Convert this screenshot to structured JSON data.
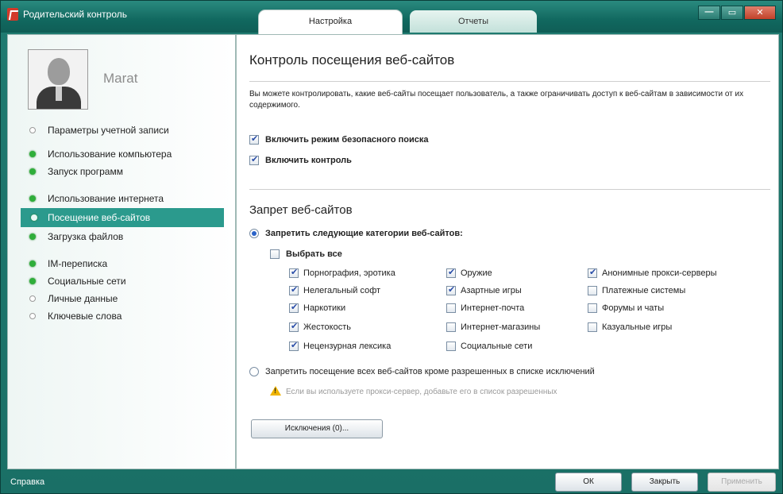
{
  "window": {
    "title": "Родительский контроль",
    "tabs": [
      {
        "label": "Настройка",
        "active": true
      },
      {
        "label": "Отчеты",
        "active": false
      }
    ],
    "controls": {
      "minimize": "—",
      "maximize": "▭",
      "close": "✕"
    }
  },
  "sidebar": {
    "user_name": "Marat",
    "items": [
      {
        "label": "Параметры учетной записи",
        "status": "off"
      },
      {
        "label": "Использование компьютера",
        "status": "on"
      },
      {
        "label": "Запуск программ",
        "status": "on"
      },
      {
        "label": "Использование интернета",
        "status": "on"
      },
      {
        "label": "Посещение веб-сайтов",
        "status": "on",
        "selected": true
      },
      {
        "label": "Загрузка файлов",
        "status": "on"
      },
      {
        "label": "IM-переписка",
        "status": "on"
      },
      {
        "label": "Социальные сети",
        "status": "on"
      },
      {
        "label": "Личные данные",
        "status": "off"
      },
      {
        "label": "Ключевые слова",
        "status": "off"
      }
    ]
  },
  "main": {
    "title": "Контроль посещения веб-сайтов",
    "description": "Вы можете контролировать, какие веб-сайты посещает пользователь, а также ограничивать доступ к веб-сайтам в зависимости от их содержимого.",
    "safe_search_label": "Включить режим безопасного поиска",
    "safe_search_checked": true,
    "control_label": "Включить контроль",
    "control_checked": true,
    "block_title": "Запрет веб-сайтов",
    "block_categories_label": "Запретить следующие категории веб-сайтов:",
    "block_categories_selected": true,
    "select_all_label": "Выбрать все",
    "select_all_checked": false,
    "categories": [
      {
        "label": "Порнография, эротика",
        "checked": true
      },
      {
        "label": "Нелегальный софт",
        "checked": true
      },
      {
        "label": "Наркотики",
        "checked": true
      },
      {
        "label": "Жестокость",
        "checked": true
      },
      {
        "label": "Нецензурная лексика",
        "checked": true
      },
      {
        "label": "Оружие",
        "checked": true
      },
      {
        "label": "Азартные игры",
        "checked": true
      },
      {
        "label": "Интернет-почта",
        "checked": false
      },
      {
        "label": "Интернет-магазины",
        "checked": false
      },
      {
        "label": "Социальные сети",
        "checked": false
      },
      {
        "label": "Анонимные прокси-серверы",
        "checked": true
      },
      {
        "label": "Платежные системы",
        "checked": false
      },
      {
        "label": "Форумы и чаты",
        "checked": false
      },
      {
        "label": "Казуальные игры",
        "checked": false
      }
    ],
    "block_all_label": "Запретить посещение всех веб-сайтов кроме разрешенных в списке исключений",
    "block_all_selected": false,
    "proxy_hint": "Если вы используете прокси-сервер, добавьте его в список разрешенных",
    "exclusions_button": "Исключения (0)..."
  },
  "footer": {
    "help_label": "Справка",
    "ok_label": "ОК",
    "close_label": "Закрыть",
    "apply_label": "Применить"
  },
  "colors": {
    "accent": "#2b9a8d",
    "frame": "#1a6f66",
    "status_on": "#2fae3a"
  }
}
